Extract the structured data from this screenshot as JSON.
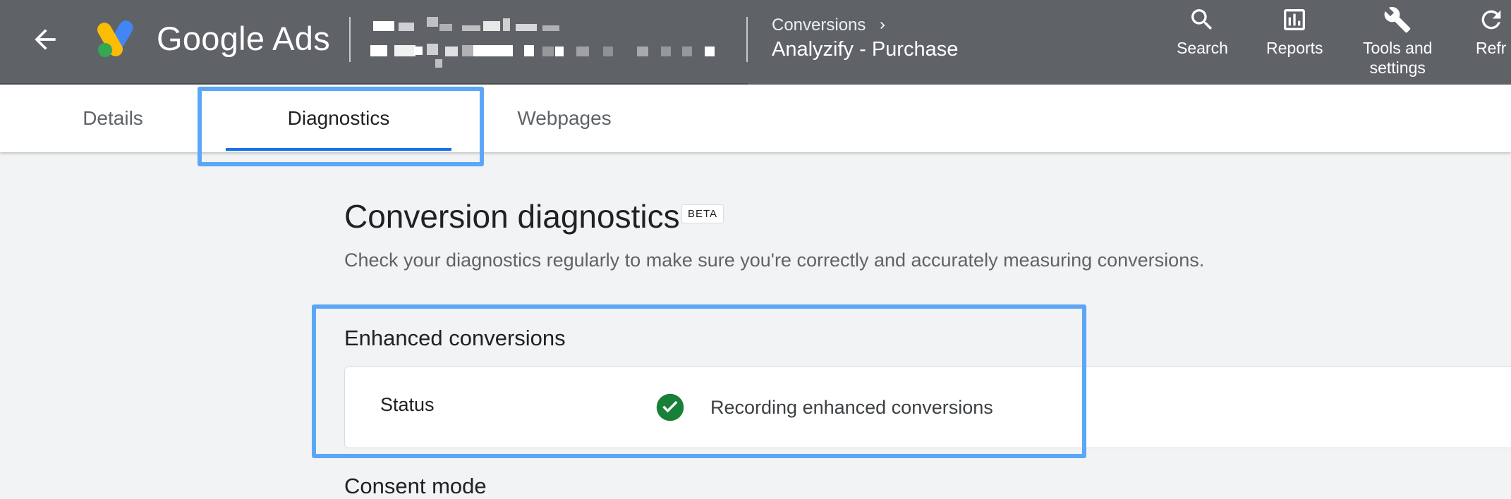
{
  "header": {
    "app_name": "Google Ads",
    "breadcrumb_parent": "Conversions",
    "page_title": "Analyzify - Purchase",
    "tools": [
      {
        "label": "Search",
        "icon": "search-icon"
      },
      {
        "label": "Reports",
        "icon": "bar-chart-icon"
      },
      {
        "label": "Tools and\nsettings",
        "icon": "wrench-icon"
      },
      {
        "label": "Refr",
        "icon": "refresh-icon"
      }
    ]
  },
  "tabs": [
    {
      "label": "Details",
      "active": false
    },
    {
      "label": "Diagnostics",
      "active": true
    },
    {
      "label": "Webpages",
      "active": false
    }
  ],
  "main": {
    "title": "Conversion diagnostics",
    "badge": "BETA",
    "subtitle": "Check your diagnostics regularly to make sure you're correctly and accurately measuring conversions.",
    "enhanced": {
      "heading": "Enhanced conversions",
      "status_label": "Status",
      "status_value": "Recording enhanced conversions"
    },
    "consent_heading": "Consent mode"
  },
  "colors": {
    "header_bg": "#5f6368",
    "accent": "#1a73e8",
    "highlight": "#5ba7f5",
    "success": "#188038"
  }
}
